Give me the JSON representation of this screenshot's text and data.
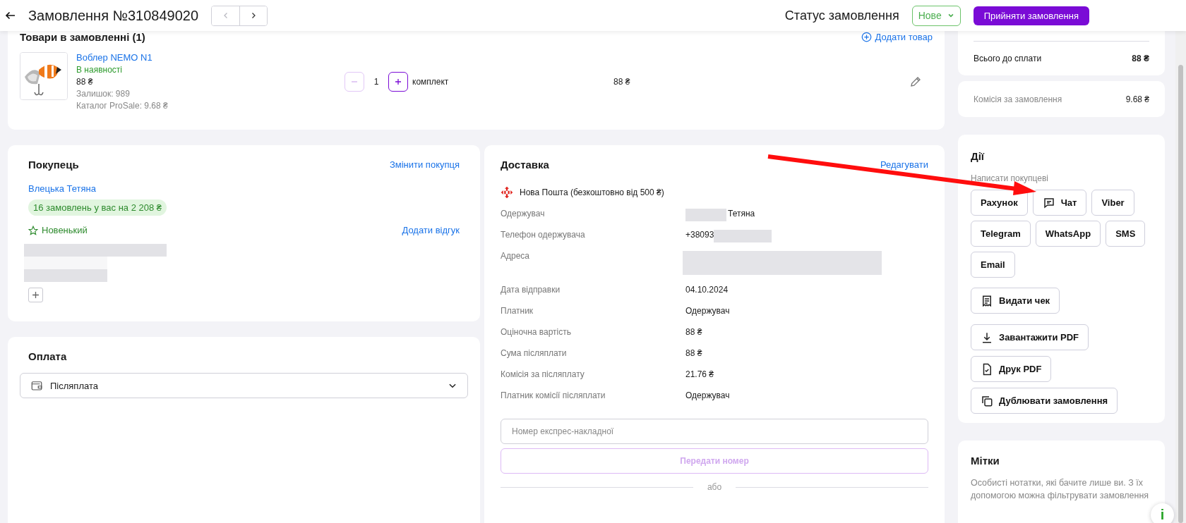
{
  "header": {
    "title": "Замовлення №310849020",
    "nav": [
      {
        "kind": "prev",
        "disabled": true
      },
      {
        "kind": "next",
        "disabled": false
      }
    ],
    "status_label": "Статус замовлення",
    "status_value": "Нове",
    "accept_button": "Прийняти замовлення"
  },
  "products": {
    "title": "Товари в замовленні (1)",
    "add_link": "Додати товар",
    "items": [
      {
        "name": "Воблер NEMO N1",
        "availability": "В наявності",
        "price": "88 ₴",
        "stock": "Залишок: 989",
        "catalog": "Каталог ProSale: 9.68 ₴",
        "quantity": "1",
        "unit": "комплект",
        "total": "88 ₴",
        "decrease_disabled": true
      }
    ]
  },
  "buyer": {
    "title": "Покупець",
    "change_link": "Змінити покупця",
    "name": "Влецька Тетяна",
    "orders_badge": "16 замовлень у вас на 2 208 ₴",
    "status": "Новенький",
    "review_link": "Додати відгук"
  },
  "payment": {
    "title": "Оплата",
    "method": "Післяплата"
  },
  "delivery": {
    "title": "Доставка",
    "edit_link": "Редагувати",
    "carrier": "Нова Пошта (безкоштовно від 500 ₴)",
    "fields": [
      {
        "label": "Одержувач",
        "value": "Тетяна",
        "kind": "redacted_prefix"
      },
      {
        "label": "Телефон одержувача",
        "value": "+38093",
        "kind": "redacted_suffix"
      },
      {
        "label": "Адреса",
        "kind": "redacted"
      },
      {
        "label": "Дата відправки",
        "value": "04.10.2024",
        "kind": "plain"
      },
      {
        "label": "Платник",
        "value": "Одержувач",
        "kind": "plain"
      },
      {
        "label": "Оціночна вартість",
        "value": "88 ₴",
        "kind": "plain"
      },
      {
        "label": "Сума післяплати",
        "value": "88 ₴",
        "kind": "plain"
      },
      {
        "label": "Комісія за післяплату",
        "value": "21.76 ₴",
        "kind": "plain"
      },
      {
        "label": "Платник комісії післяплати",
        "value": "Одержувач",
        "kind": "plain"
      }
    ],
    "waybill": {
      "placeholder": "Номер експрес-накладної"
    },
    "submit_button": {
      "label": "Передати номер",
      "disabled": true
    },
    "divider_text": "або"
  },
  "summary": [
    {
      "kind": "total",
      "label": "Всього до сплати",
      "value": "88 ₴"
    },
    {
      "kind": "commission",
      "label": "Комісія за замовлення",
      "value": "9.68 ₴"
    }
  ],
  "actions": {
    "title": "Дії",
    "subtitle": "Написати покупцеві",
    "messengers": [
      {
        "kind": "plain",
        "label": "Рахунок"
      },
      {
        "kind": "chat",
        "label": "Чат"
      },
      {
        "kind": "plain",
        "label": "Viber"
      },
      {
        "kind": "plain",
        "label": "Telegram"
      },
      {
        "kind": "plain",
        "label": "WhatsApp"
      },
      {
        "kind": "plain",
        "label": "SMS"
      },
      {
        "kind": "plain",
        "label": "Email"
      }
    ],
    "buttons": [
      {
        "kind": "receipt",
        "label": "Видати чек"
      },
      {
        "kind": "download",
        "label": "Завантажити PDF"
      },
      {
        "kind": "print",
        "label": "Друк PDF"
      },
      {
        "kind": "duplicate",
        "label": "Дублювати замовлення"
      }
    ]
  },
  "marks": {
    "title": "Мітки",
    "description": "Особисті нотатки, які бачите лише ви. З їх допомогою можна фільтрувати замовлення"
  },
  "help_button": "i",
  "annotation": {
    "kind": "arrow"
  }
}
